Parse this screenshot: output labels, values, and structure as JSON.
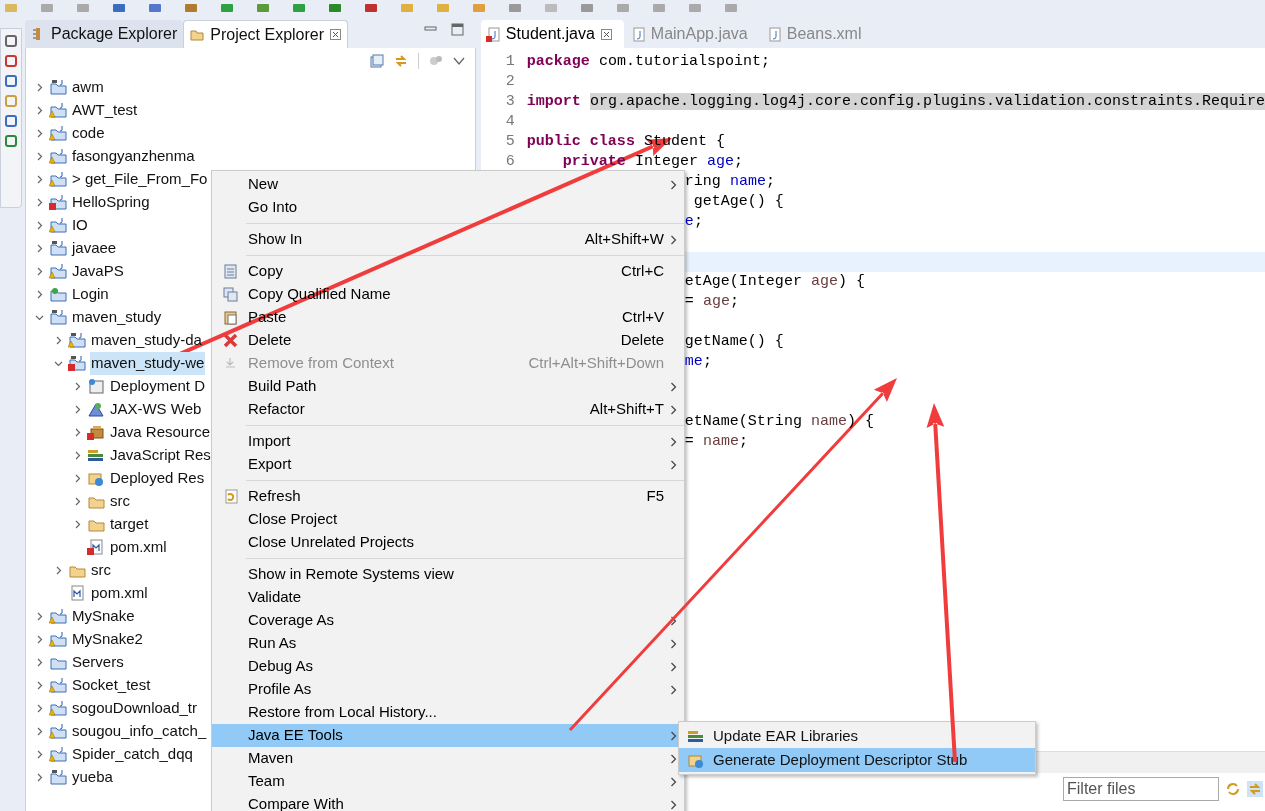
{
  "explorer": {
    "tabs": [
      {
        "label": "Package Explorer",
        "selected": false
      },
      {
        "label": "Project Explorer",
        "selected": true
      }
    ],
    "tree": [
      {
        "label": "awm",
        "kind": "maven",
        "warning": false,
        "error": false,
        "expanded": false,
        "selected": false
      },
      {
        "label": "AWT_test",
        "kind": "java",
        "warning": true,
        "error": false,
        "expanded": false,
        "selected": false
      },
      {
        "label": "code",
        "kind": "java",
        "warning": true,
        "error": false,
        "expanded": false,
        "selected": false
      },
      {
        "label": "fasongyanzhenma",
        "kind": "java",
        "warning": true,
        "error": false,
        "expanded": false,
        "selected": false
      },
      {
        "label": "> get_File_From_Fo",
        "kind": "java",
        "warning": true,
        "error": false,
        "expanded": false,
        "selected": false
      },
      {
        "label": "HelloSpring",
        "kind": "java",
        "warning": false,
        "error": true,
        "expanded": false,
        "selected": false
      },
      {
        "label": "IO",
        "kind": "java",
        "warning": true,
        "error": false,
        "expanded": false,
        "selected": false
      },
      {
        "label": "javaee",
        "kind": "maven",
        "warning": false,
        "error": false,
        "expanded": false,
        "selected": false
      },
      {
        "label": "JavaPS",
        "kind": "java",
        "warning": true,
        "error": false,
        "expanded": false,
        "selected": false
      },
      {
        "label": "Login",
        "kind": "web",
        "warning": false,
        "error": false,
        "expanded": false,
        "selected": false
      },
      {
        "label": "maven_study",
        "kind": "maven",
        "warning": false,
        "error": false,
        "expanded": true,
        "selected": false,
        "children": [
          {
            "label": "maven_study-da",
            "kind": "maven",
            "warning": true,
            "error": false,
            "expanded": false,
            "selected": false
          },
          {
            "label": "maven_study-we",
            "kind": "maven",
            "warning": false,
            "error": true,
            "expanded": true,
            "selected": true,
            "children": [
              {
                "label": "Deployment D",
                "kind": "descriptor",
                "warning": false,
                "error": false,
                "expanded": false,
                "selected": false
              },
              {
                "label": "JAX-WS Web",
                "kind": "service",
                "warning": false,
                "error": false,
                "expanded": false,
                "selected": false
              },
              {
                "label": "Java Resource",
                "kind": "resources",
                "warning": false,
                "error": true,
                "expanded": false,
                "selected": false
              },
              {
                "label": "JavaScript Res",
                "kind": "books",
                "warning": false,
                "error": false,
                "expanded": false,
                "selected": false
              },
              {
                "label": "Deployed Res",
                "kind": "globe",
                "warning": false,
                "error": false,
                "expanded": false,
                "selected": false
              },
              {
                "label": "src",
                "kind": "folder",
                "warning": false,
                "error": false,
                "expanded": false,
                "selected": false
              },
              {
                "label": "target",
                "kind": "folder",
                "warning": false,
                "error": false,
                "expanded": false,
                "selected": false
              },
              {
                "label": "pom.xml",
                "kind": "file",
                "warning": false,
                "error": true,
                "selected": false
              }
            ]
          },
          {
            "label": "src",
            "kind": "folder",
            "warning": false,
            "error": false,
            "expanded": false,
            "selected": false
          },
          {
            "label": "pom.xml",
            "kind": "file",
            "warning": false,
            "error": false,
            "selected": false
          }
        ]
      },
      {
        "label": "MySnake",
        "kind": "java",
        "warning": true,
        "error": false,
        "expanded": false,
        "selected": false
      },
      {
        "label": "MySnake2",
        "kind": "java",
        "warning": true,
        "error": false,
        "expanded": false,
        "selected": false
      },
      {
        "label": "Servers",
        "kind": "plain",
        "warning": false,
        "error": false,
        "expanded": false,
        "selected": false
      },
      {
        "label": "Socket_test",
        "kind": "java",
        "warning": true,
        "error": false,
        "expanded": false,
        "selected": false
      },
      {
        "label": "sogouDownload_tr",
        "kind": "java",
        "warning": true,
        "error": false,
        "expanded": false,
        "selected": false
      },
      {
        "label": "sougou_info_catch_",
        "kind": "java",
        "warning": true,
        "error": false,
        "expanded": false,
        "selected": false
      },
      {
        "label": "Spider_catch_dqq",
        "kind": "java",
        "warning": true,
        "error": false,
        "expanded": false,
        "selected": false
      },
      {
        "label": "yueba",
        "kind": "maven",
        "warning": false,
        "error": false,
        "expanded": false,
        "selected": false
      }
    ]
  },
  "editor": {
    "tabs": [
      {
        "label": "Student.java",
        "selected": true
      },
      {
        "label": "MainApp.java",
        "selected": false
      },
      {
        "label": "Beans.xml",
        "selected": false
      }
    ],
    "lines": [
      {
        "number": "1",
        "current": false,
        "tokens": [
          {
            "kind": "keyword",
            "text": "package"
          },
          {
            "kind": "plain",
            "text": " com.tutorialspoint;"
          }
        ]
      },
      {
        "number": "2",
        "current": false
      },
      {
        "number": "3",
        "current": false,
        "tokens": [
          {
            "kind": "keyword",
            "text": "import "
          },
          {
            "kind": "marked",
            "text": "org.apache.logging.log4j.core.config.plugins.validation.constraints.Require"
          }
        ]
      },
      {
        "number": "4",
        "current": false
      },
      {
        "number": "5",
        "current": false,
        "tokens": [
          {
            "kind": "keyword",
            "text": "public class"
          },
          {
            "kind": "plain",
            "text": " Student {"
          }
        ]
      },
      {
        "number": "6",
        "current": false,
        "tokens": [
          {
            "kind": "keyword",
            "text": "    private"
          },
          {
            "kind": "plain",
            "text": " Integer "
          },
          {
            "kind": "field",
            "text": "age"
          },
          {
            "kind": "plain",
            "text": ";"
          }
        ]
      },
      {
        "current": false,
        "tokens": [
          {
            "kind": "plain",
            "text": "ring "
          },
          {
            "kind": "field",
            "text": "name"
          },
          {
            "kind": "plain",
            "text": ";"
          }
        ]
      },
      {
        "current": false,
        "tokens": [
          {
            "kind": "plain",
            "text": " getAge() {"
          }
        ]
      },
      {
        "current": false,
        "tokens": [
          {
            "kind": "field",
            "text": "e"
          },
          {
            "kind": "plain",
            "text": ";"
          }
        ]
      },
      {
        "current": false
      },
      {
        "current": true
      },
      {
        "current": false,
        "tokens": [
          {
            "kind": "plain",
            "text": "etAge(Integer "
          },
          {
            "kind": "param",
            "text": "age"
          },
          {
            "kind": "plain",
            "text": ") {"
          }
        ]
      },
      {
        "current": false,
        "tokens": [
          {
            "kind": "plain",
            "text": "= "
          },
          {
            "kind": "param",
            "text": "age"
          },
          {
            "kind": "plain",
            "text": ";"
          }
        ]
      },
      {
        "current": false
      },
      {
        "current": false,
        "tokens": [
          {
            "kind": "plain",
            "text": "getName() {"
          }
        ]
      },
      {
        "current": false,
        "tokens": [
          {
            "kind": "field",
            "text": "me"
          },
          {
            "kind": "plain",
            "text": ";"
          }
        ]
      },
      {
        "current": false
      },
      {
        "current": false
      },
      {
        "current": false,
        "tokens": [
          {
            "kind": "plain",
            "text": "etName(String "
          },
          {
            "kind": "param",
            "text": "name"
          },
          {
            "kind": "plain",
            "text": ") {"
          }
        ]
      },
      {
        "current": false,
        "tokens": [
          {
            "kind": "plain",
            "text": "= "
          },
          {
            "kind": "param",
            "text": "name"
          },
          {
            "kind": "plain",
            "text": ";"
          }
        ]
      }
    ]
  },
  "context_menu": {
    "groups": [
      [
        {
          "label": "New",
          "submenu": true,
          "selected": false,
          "disabled": false
        },
        {
          "label": "Go Into",
          "submenu": false,
          "selected": false,
          "disabled": false
        }
      ],
      [
        {
          "label": "Show In",
          "shortcut": "Alt+Shift+W",
          "submenu": true,
          "selected": false,
          "disabled": false
        }
      ],
      [
        {
          "label": "Copy",
          "kind": "copy",
          "shortcut": "Ctrl+C",
          "submenu": false,
          "selected": false,
          "disabled": false
        },
        {
          "label": "Copy Qualified Name",
          "kind": "copy-name",
          "submenu": false,
          "selected": false,
          "disabled": false
        },
        {
          "label": "Paste",
          "kind": "paste",
          "shortcut": "Ctrl+V",
          "submenu": false,
          "selected": false,
          "disabled": false
        },
        {
          "label": "Delete",
          "kind": "delete",
          "shortcut": "Delete",
          "submenu": false,
          "selected": false,
          "disabled": false
        },
        {
          "label": "Remove from Context",
          "kind": "remove",
          "shortcut": "Ctrl+Alt+Shift+Down",
          "submenu": false,
          "selected": false,
          "disabled": true
        },
        {
          "label": "Build Path",
          "submenu": true,
          "selected": false,
          "disabled": false
        },
        {
          "label": "Refactor",
          "shortcut": "Alt+Shift+T",
          "submenu": true,
          "selected": false,
          "disabled": false
        }
      ],
      [
        {
          "label": "Import",
          "submenu": true,
          "selected": false,
          "disabled": false
        },
        {
          "label": "Export",
          "submenu": true,
          "selected": false,
          "disabled": false
        }
      ],
      [
        {
          "label": "Refresh",
          "kind": "refresh",
          "shortcut": "F5",
          "submenu": false,
          "selected": false,
          "disabled": false
        },
        {
          "label": "Close Project",
          "submenu": false,
          "selected": false,
          "disabled": false
        },
        {
          "label": "Close Unrelated Projects",
          "submenu": false,
          "selected": false,
          "disabled": false
        }
      ],
      [
        {
          "label": "Show in Remote Systems view",
          "submenu": false,
          "selected": false,
          "disabled": false
        },
        {
          "label": "Validate",
          "submenu": false,
          "selected": false,
          "disabled": false
        },
        {
          "label": "Coverage As",
          "submenu": true,
          "selected": false,
          "disabled": false
        },
        {
          "label": "Run As",
          "submenu": true,
          "selected": false,
          "disabled": false
        },
        {
          "label": "Debug As",
          "submenu": true,
          "selected": false,
          "disabled": false
        },
        {
          "label": "Profile As",
          "submenu": true,
          "selected": false,
          "disabled": false
        },
        {
          "label": "Restore from Local History...",
          "submenu": false,
          "selected": false,
          "disabled": false
        },
        {
          "label": "Java EE Tools",
          "submenu": true,
          "selected": true,
          "disabled": false
        },
        {
          "label": "Maven",
          "submenu": true,
          "selected": false,
          "disabled": false
        },
        {
          "label": "Team",
          "submenu": true,
          "selected": false,
          "disabled": false
        },
        {
          "label": "Compare With",
          "submenu": true,
          "selected": false,
          "disabled": false
        }
      ]
    ]
  },
  "submenu": [
    {
      "label": "Update EAR Libraries",
      "kind": "books",
      "selected": false
    },
    {
      "label": "Generate Deployment Descriptor Stub",
      "kind": "globe",
      "selected": true
    }
  ],
  "filter": {
    "placeholder": "Filter files"
  }
}
